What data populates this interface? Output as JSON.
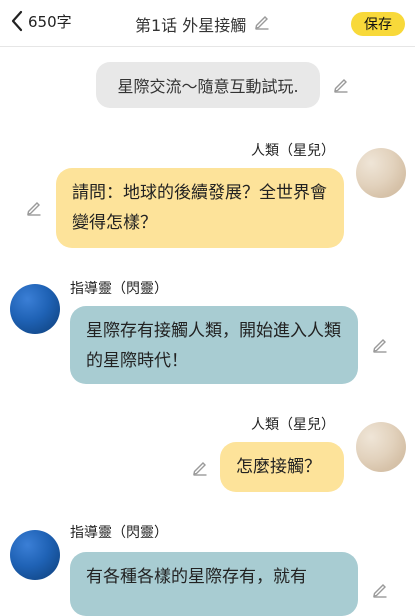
{
  "header": {
    "count": "650字",
    "title": "第1话 外星接觸",
    "save_label": "保存"
  },
  "system": {
    "text": "星際交流～隨意互動試玩."
  },
  "messages": [
    {
      "speaker": "人類（星兒）",
      "text": "請問：地球的後續發展？全世界會變得怎樣？"
    },
    {
      "speaker": "指導靈（閃靈）",
      "text": "星際存有接觸人類，開始進入人類的星際時代！"
    },
    {
      "speaker": "人類（星兒）",
      "text": "怎麼接觸？"
    },
    {
      "speaker": "指導靈（閃靈）",
      "text": "有各種各樣的星際存有，就有"
    }
  ]
}
